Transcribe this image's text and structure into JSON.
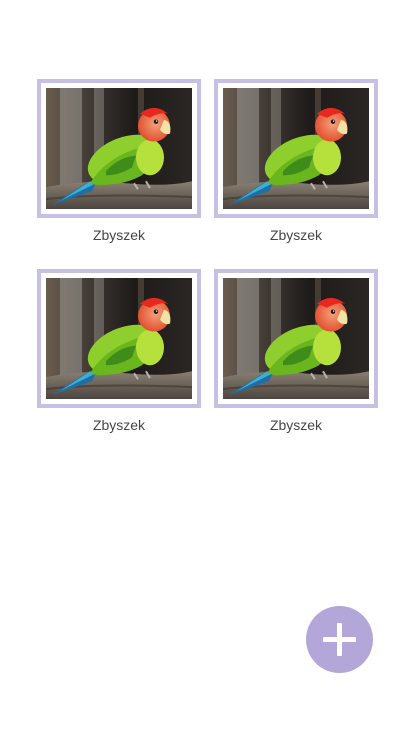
{
  "gallery": {
    "items": [
      {
        "label": "Zbyszek",
        "image": "lovebird-parrot-photo"
      },
      {
        "label": "Zbyszek",
        "image": "lovebird-parrot-photo"
      },
      {
        "label": "Zbyszek",
        "image": "lovebird-parrot-photo"
      },
      {
        "label": "Zbyszek",
        "image": "lovebird-parrot-photo"
      }
    ]
  },
  "fab": {
    "icon": "plus-icon"
  },
  "colors": {
    "frame": "#c8c0e4",
    "fab": "#b3a6d8",
    "caption": "#454545"
  }
}
